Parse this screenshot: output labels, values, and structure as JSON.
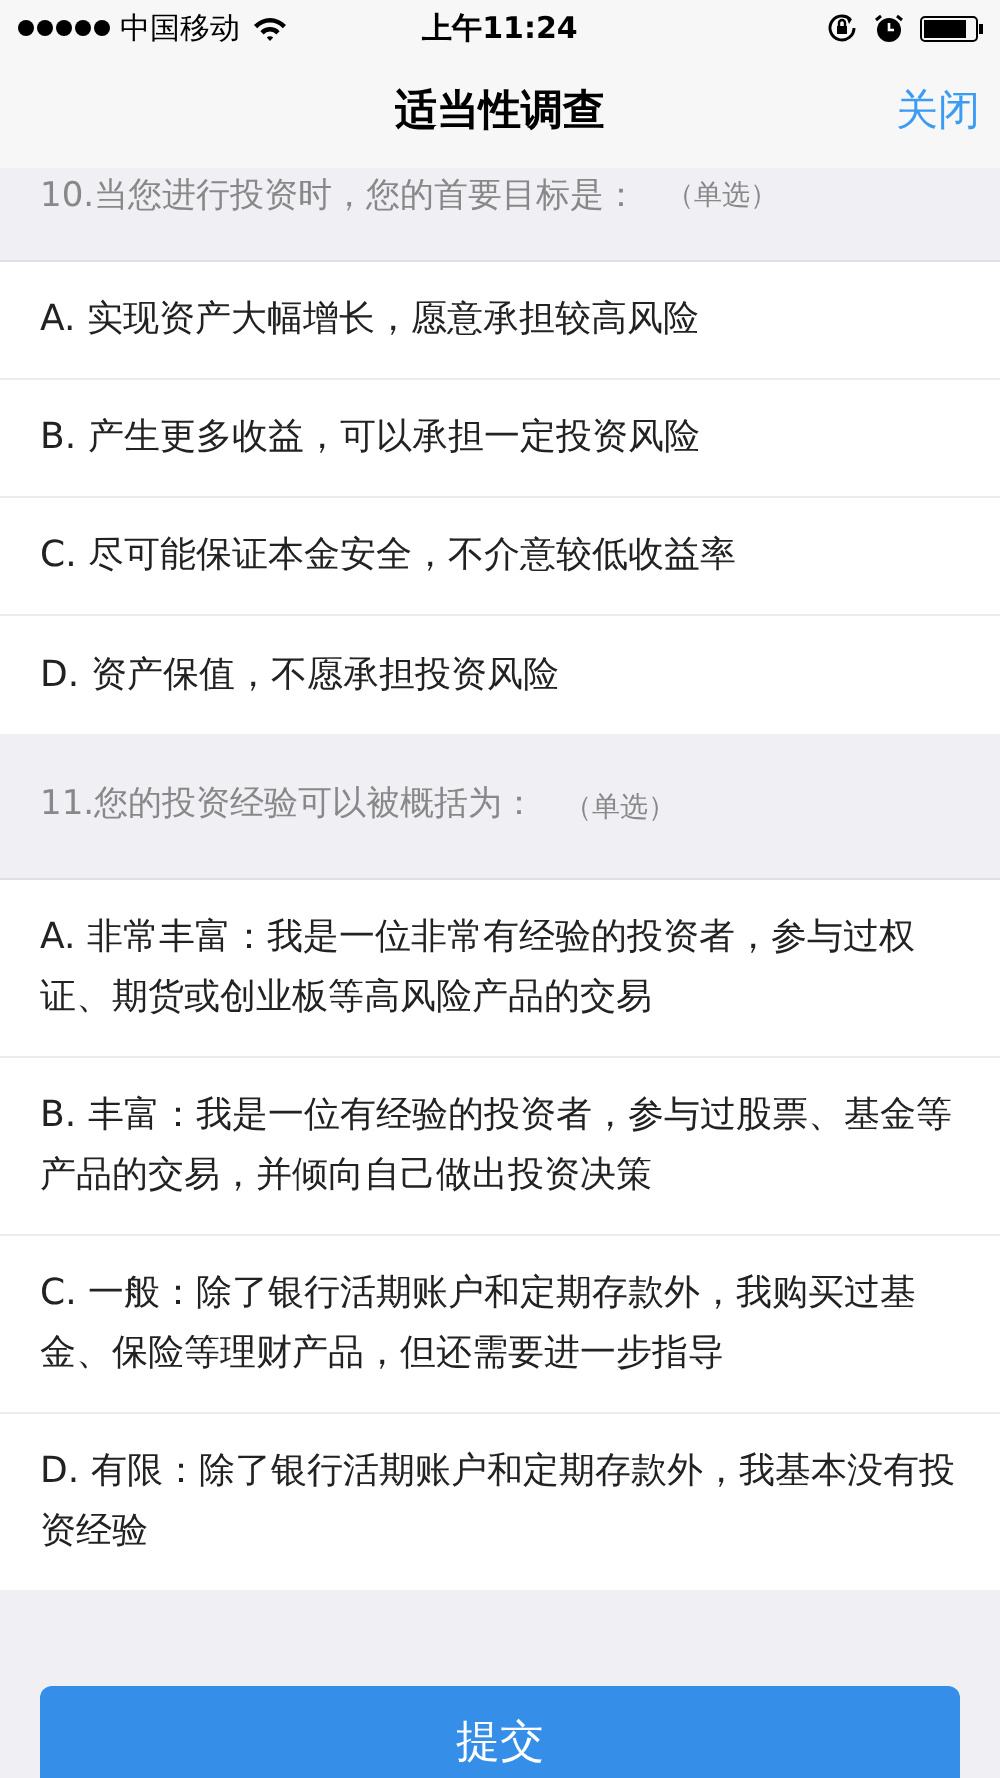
{
  "status_bar": {
    "carrier": "中国移动",
    "time": "上午11:24"
  },
  "nav": {
    "title": "适当性调查",
    "close": "关闭"
  },
  "questions": [
    {
      "title": "10.当您进行投资时，您的首要目标是：",
      "type": "（单选）",
      "options": [
        {
          "text": "A. 实现资产大幅增长，愿意承担较高风险"
        },
        {
          "text": "B. 产生更多收益，可以承担一定投资风险"
        },
        {
          "text": "C. 尽可能保证本金安全，不介意较低收益率"
        },
        {
          "text": "D. 资产保值，不愿承担投资风险"
        }
      ]
    },
    {
      "title": "11.您的投资经验可以被概括为：",
      "type": "（单选）",
      "options": [
        {
          "text": "A. 非常丰富：我是一位非常有经验的投资者，参与过权证、期货或创业板等高风险产品的交易"
        },
        {
          "text": "B. 丰富：我是一位有经验的投资者，参与过股票、基金等产品的交易，并倾向自己做出投资决策"
        },
        {
          "text": "C. 一般：除了银行活期账户和定期存款外，我购买过基金、保险等理财产品，但还需要进一步指导"
        },
        {
          "text": "D. 有限：除了银行活期账户和定期存款外，我基本没有投资经验"
        }
      ]
    }
  ],
  "submit": "提交"
}
